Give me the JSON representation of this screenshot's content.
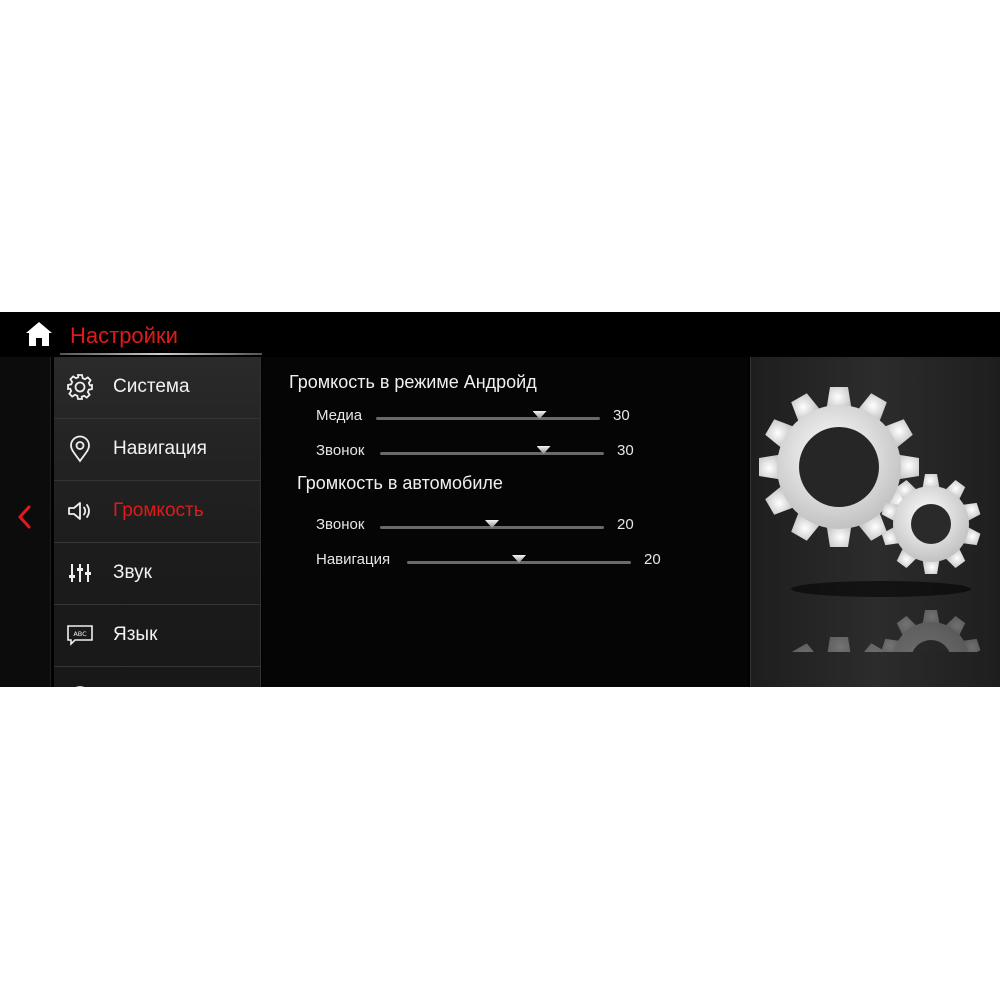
{
  "header": {
    "title": "Настройки",
    "home_icon": "home-icon"
  },
  "nav": {
    "back_icon": "chevron-left-icon",
    "accent_color": "#e01a1a"
  },
  "menu": {
    "items": [
      {
        "label": "Система",
        "icon": "gear-icon",
        "active": false
      },
      {
        "label": "Навигация",
        "icon": "map-pin-icon",
        "active": false
      },
      {
        "label": "Громкость",
        "icon": "speaker-icon",
        "active": true
      },
      {
        "label": "Звук",
        "icon": "equalizer-icon",
        "active": false
      },
      {
        "label": "Язык",
        "icon": "keyboard-abc-icon",
        "active": false
      }
    ]
  },
  "volume": {
    "android": {
      "title": "Громкость в режиме Андройд",
      "rows": [
        {
          "label": "Медиа",
          "value": "30",
          "level": 0.73
        },
        {
          "label": "Звонок",
          "value": "30",
          "level": 0.73
        }
      ]
    },
    "car": {
      "title": "Громкость в автомобиле",
      "rows": [
        {
          "label": "Звонок",
          "value": "20",
          "level": 0.5
        },
        {
          "label": "Навигация",
          "value": "20",
          "level": 0.5
        }
      ]
    }
  },
  "decor": {
    "image_icon": "gears-icon"
  }
}
